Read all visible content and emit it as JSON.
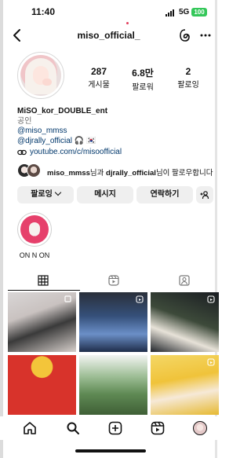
{
  "status_bar": {
    "time": "11:40",
    "network": "5G",
    "battery": "100"
  },
  "header": {
    "username": "miso_official_"
  },
  "stats": [
    {
      "value": "287",
      "label": "게시물"
    },
    {
      "value": "6.8만",
      "label": "팔로워"
    },
    {
      "value": "2",
      "label": "팔로잉"
    }
  ],
  "bio": {
    "display_name": "MiSO_kor_DOUBLE_ent",
    "category": "공인",
    "mention_1": "@miso_mmss",
    "mention_2": "@djrally_official",
    "mention_2_suffix": " 🎧 🇰🇷",
    "link": "youtube.com/c/misoofficial"
  },
  "followed_by": {
    "user_1": "miso_mmss",
    "connector": "님과 ",
    "user_2": "djrally_official",
    "suffix": "님이 팔로우합니다"
  },
  "actions": {
    "following": "팔로잉",
    "message": "메시지",
    "contact": "연락하기"
  },
  "highlight": {
    "label": "ON N ON"
  },
  "icons": {
    "back": "back-arrow-icon",
    "threads": "threads-icon",
    "more": "more-icon",
    "grid": "grid-icon",
    "reels": "reels-icon",
    "tagged": "tagged-icon",
    "home": "home-icon",
    "search": "search-icon",
    "create": "create-icon",
    "nav_reels": "reels-icon",
    "profile": "profile-avatar"
  },
  "colors": {
    "link": "#00376b",
    "battery": "#34c759",
    "button_bg": "#efefef"
  }
}
